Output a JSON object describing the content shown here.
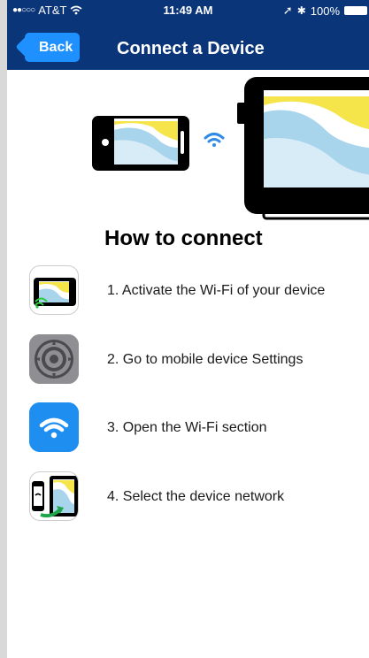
{
  "status_bar": {
    "carrier": "AT&T",
    "time": "11:49 AM",
    "battery": "100%"
  },
  "nav": {
    "back_label": "Back",
    "title": "Connect a Device"
  },
  "heading": "How to connect",
  "steps": [
    {
      "icon": "device-wifi-icon",
      "text": "1. Activate the Wi-Fi of your device"
    },
    {
      "icon": "settings-gear-icon",
      "text": "2. Go to mobile device Settings"
    },
    {
      "icon": "wifi-icon",
      "text": "3. Open the Wi-Fi section"
    },
    {
      "icon": "select-network-icon",
      "text": "4. Select the device network"
    }
  ],
  "colors": {
    "nav_bar": "#0a3578",
    "back_button": "#1e90ff",
    "wifi_blue": "#2f8be6",
    "chart_yellow": "#f5e44a",
    "chart_blue": "#a8d4ec"
  }
}
